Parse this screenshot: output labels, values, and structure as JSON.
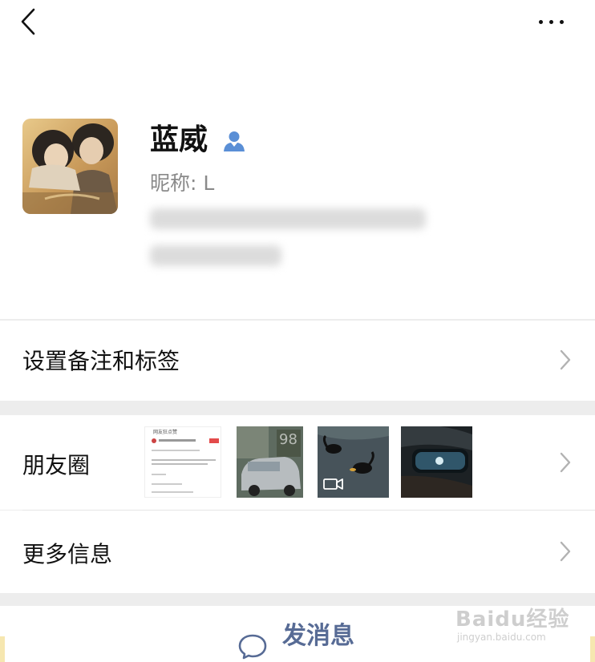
{
  "header": {
    "back_icon": "chevron-left-icon",
    "more_icon": "more-dots-icon"
  },
  "profile": {
    "name": "蓝威",
    "verify_icon": "person-icon",
    "nickname": "昵称: L"
  },
  "menu": {
    "remark_label": "设置备注和标签",
    "moments_label": "朋友圈",
    "more_info_label": "更多信息"
  },
  "moments_preview": {
    "thumb1_title": "网友狂点赞",
    "thumb4_label": "98"
  },
  "send_message": {
    "label": "发消息",
    "icon": "chat-bubble-icon"
  },
  "watermark": {
    "logo": "Baidu经验",
    "url": "jingyan.baidu.com"
  },
  "colors": {
    "accent": "#576b95",
    "verify": "#5a8fd6",
    "background": "#ededed"
  }
}
